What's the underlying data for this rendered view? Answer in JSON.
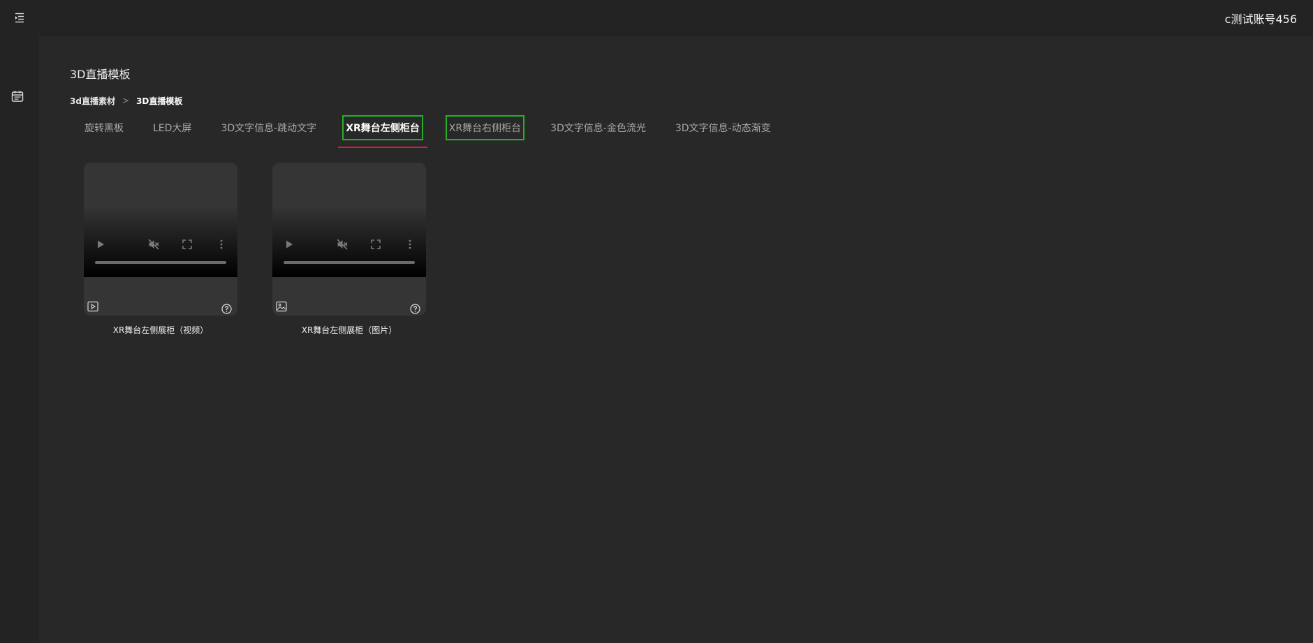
{
  "header": {
    "menu_icon": "menu-fold-icon",
    "username": "c测试账号456"
  },
  "sidebar": {
    "items": [
      {
        "icon": "calendar-icon"
      }
    ]
  },
  "page": {
    "title": "3D直播模板"
  },
  "breadcrumb": {
    "parent": "3d直播素材",
    "separator": ">",
    "current": "3D直播模板"
  },
  "tabs": [
    {
      "label": "旋转黑板",
      "active": false
    },
    {
      "label": "LED大屏",
      "active": false
    },
    {
      "label": "3D文字信息-跳动文字",
      "active": false
    },
    {
      "label": "XR舞台左侧柜台",
      "active": true
    },
    {
      "label": "XR舞台右侧柜台",
      "active": false
    },
    {
      "label": "3D文字信息-金色流光",
      "active": false
    },
    {
      "label": "3D文字信息-动态渐变",
      "active": false
    }
  ],
  "cards": [
    {
      "title": "XR舞台左侧展柜（视频）",
      "type_icon": "video-icon",
      "help_icon": "question-circle-icon",
      "controls": [
        "play-icon",
        "muted-icon",
        "fullscreen-icon",
        "more-vertical-icon"
      ]
    },
    {
      "title": "XR舞台左侧展柜（图片）",
      "type_icon": "image-icon",
      "help_icon": "question-circle-icon",
      "controls": [
        "play-icon",
        "muted-icon",
        "fullscreen-icon",
        "more-vertical-icon"
      ]
    }
  ],
  "colors": {
    "background": "#282828",
    "header": "#232323",
    "active_tab_underline": "#e5193f",
    "highlight_outline": "#27b027"
  }
}
